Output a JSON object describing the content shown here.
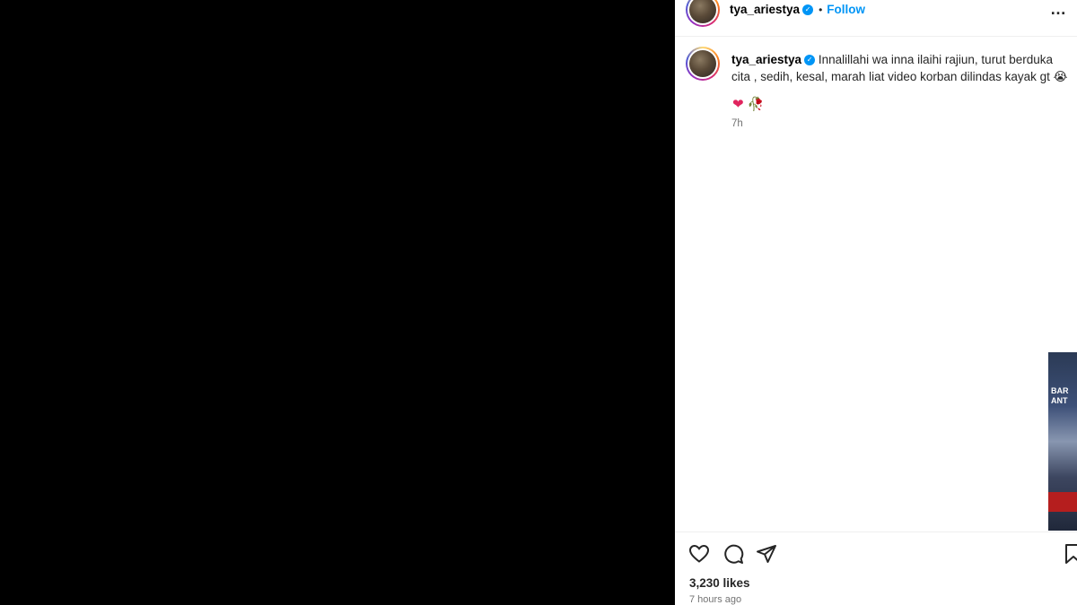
{
  "post": {
    "username": "tya_ariestya",
    "follow_label": "Follow",
    "more_label": "…"
  },
  "comment": {
    "username": "tya_ariestya",
    "text": "Innalillahi wa inna ilaihi rajiun, turut berduka cita , sedih, kesal, marah liat video korban dilindas kayak gt 😭",
    "emoji_heart": "❤",
    "emoji_leaf": "🥀",
    "time": "7h"
  },
  "thumbnail": {
    "text": "BAR\nANT"
  },
  "footer": {
    "likes": "3,230 likes",
    "time_ago": "7 hours ago"
  },
  "icons": {
    "like": "heart-outline-icon",
    "comment": "comment-bubble-icon",
    "share": "paper-plane-icon",
    "save": "bookmark-icon"
  },
  "colors": {
    "accent": "#0095f6",
    "text": "#262626",
    "muted": "#737373"
  }
}
